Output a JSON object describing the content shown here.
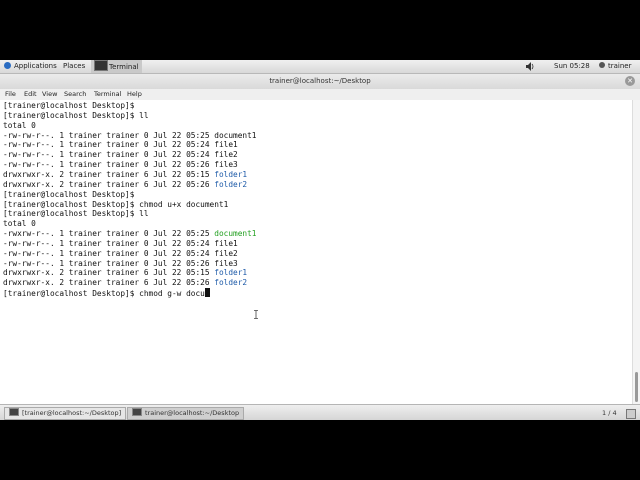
{
  "topbar": {
    "applications": "Applications",
    "places": "Places",
    "terminal": "Terminal",
    "clock": "Sun 05:28",
    "user": "trainer"
  },
  "window": {
    "title": "trainer@localhost:~/Desktop"
  },
  "menu": [
    "File",
    "Edit",
    "View",
    "Search",
    "Terminal",
    "Help"
  ],
  "terminal_lines": [
    {
      "text": "[trainer@localhost Desktop]$"
    },
    {
      "text": "[trainer@localhost Desktop]$ ll"
    },
    {
      "text": "total 0"
    },
    {
      "text": "-rw-rw-r--. 1 trainer trainer 0 Jul 22 05:25 ",
      "name": "document1",
      "kind": "file"
    },
    {
      "text": "-rw-rw-r--. 1 trainer trainer 0 Jul 22 05:24 ",
      "name": "file1",
      "kind": "file"
    },
    {
      "text": "-rw-rw-r--. 1 trainer trainer 0 Jul 22 05:24 ",
      "name": "file2",
      "kind": "file"
    },
    {
      "text": "-rw-rw-r--. 1 trainer trainer 0 Jul 22 05:26 ",
      "name": "file3",
      "kind": "file"
    },
    {
      "text": "drwxrwxr-x. 2 trainer trainer 6 Jul 22 05:15 ",
      "name": "folder1",
      "kind": "dir"
    },
    {
      "text": "drwxrwxr-x. 2 trainer trainer 6 Jul 22 05:26 ",
      "name": "folder2",
      "kind": "dir"
    },
    {
      "text": "[trainer@localhost Desktop]$"
    },
    {
      "text": "[trainer@localhost Desktop]$ chmod u+x document1"
    },
    {
      "text": "[trainer@localhost Desktop]$ ll"
    },
    {
      "text": "total 0"
    },
    {
      "text": "-rwxrw-r--. 1 trainer trainer 0 Jul 22 05:25 ",
      "name": "document1",
      "kind": "exe"
    },
    {
      "text": "-rw-rw-r--. 1 trainer trainer 0 Jul 22 05:24 ",
      "name": "file1",
      "kind": "file"
    },
    {
      "text": "-rw-rw-r--. 1 trainer trainer 0 Jul 22 05:24 ",
      "name": "file2",
      "kind": "file"
    },
    {
      "text": "-rw-rw-r--. 1 trainer trainer 0 Jul 22 05:26 ",
      "name": "file3",
      "kind": "file"
    },
    {
      "text": "drwxrwxr-x. 2 trainer trainer 6 Jul 22 05:15 ",
      "name": "folder1",
      "kind": "dir"
    },
    {
      "text": "drwxrwxr-x. 2 trainer trainer 6 Jul 22 05:26 ",
      "name": "folder2",
      "kind": "dir"
    },
    {
      "text": "[trainer@localhost Desktop]$ chmod g-w docu",
      "cursor": true
    }
  ],
  "taskbar": {
    "tasks": [
      "[trainer@localhost:~/Desktop]",
      "trainer@localhost:~/Desktop"
    ],
    "pager": "1 / 4"
  },
  "colors": {
    "directory": "#1d5aa8",
    "executable": "#22a020"
  }
}
